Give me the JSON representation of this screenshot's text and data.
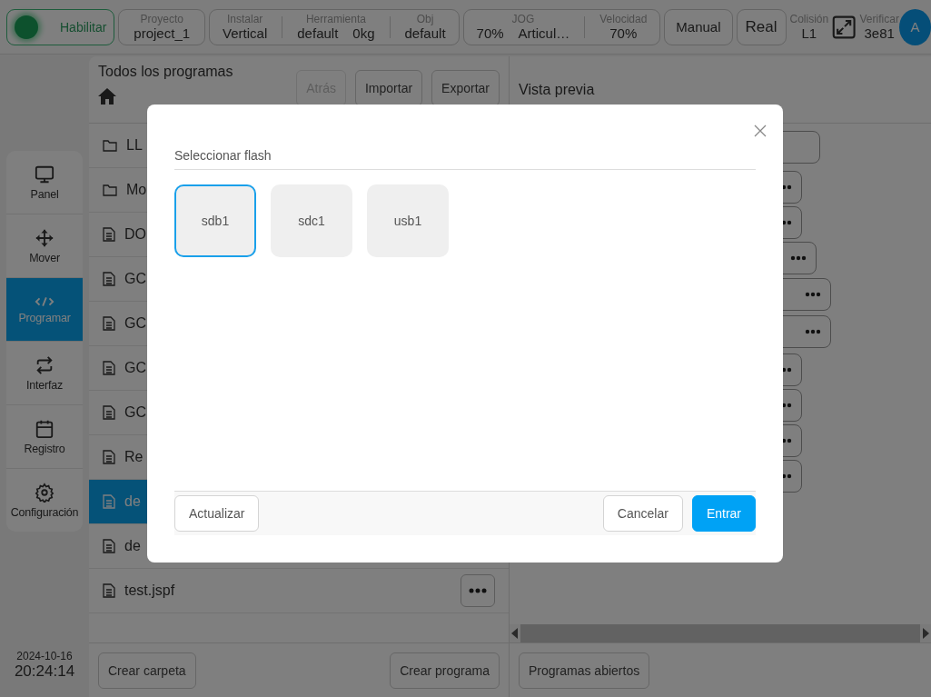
{
  "status_bar": {
    "enable": {
      "label": "Habilitar",
      "on": true
    },
    "project": {
      "label": "Proyecto",
      "value": "project_1"
    },
    "install_group": [
      {
        "label": "Instalar",
        "values": [
          "Vertical"
        ]
      },
      {
        "label": "Herramienta",
        "values": [
          "default",
          "0kg"
        ]
      },
      {
        "label": "Obj",
        "values": [
          "default"
        ]
      }
    ],
    "jog_group": [
      {
        "label": "JOG",
        "values": [
          "70%",
          "Articul…"
        ]
      },
      {
        "label": "Velocidad",
        "values": [
          "70%"
        ]
      }
    ],
    "mode_buttons": [
      "Manual",
      "Real"
    ],
    "collision": {
      "label": "Colisión",
      "value": "L1"
    },
    "verify": {
      "label": "Verificar",
      "value": "3e81"
    },
    "avatar": "A"
  },
  "sidebar": {
    "items": [
      {
        "label": "Panel",
        "selected": false
      },
      {
        "label": "Mover",
        "selected": false
      },
      {
        "label": "Programar",
        "selected": true
      },
      {
        "label": "Interfaz",
        "selected": false
      },
      {
        "label": "Registro",
        "selected": false
      },
      {
        "label": "Configuración",
        "selected": false
      }
    ],
    "date": "2024-10-16",
    "time": "20:24:14"
  },
  "file_panel": {
    "title": "Todos los programas",
    "buttons": [
      {
        "label": "Atrás",
        "disabled": true
      },
      {
        "label": "Importar",
        "disabled": false
      },
      {
        "label": "Exportar",
        "disabled": false
      }
    ],
    "rows": [
      {
        "kind": "folder",
        "name": "LL",
        "selected": false
      },
      {
        "kind": "folder",
        "name": "Mo",
        "selected": false
      },
      {
        "kind": "file",
        "name": "DO",
        "selected": false
      },
      {
        "kind": "file",
        "name": "GC",
        "selected": false
      },
      {
        "kind": "file",
        "name": "GC",
        "selected": false
      },
      {
        "kind": "file",
        "name": "GC",
        "selected": false
      },
      {
        "kind": "file",
        "name": "GC",
        "selected": false
      },
      {
        "kind": "file",
        "name": "Re",
        "selected": false
      },
      {
        "kind": "file",
        "name": "de",
        "selected": true
      },
      {
        "kind": "file",
        "name": "de",
        "selected": false
      },
      {
        "kind": "file",
        "name": "test.jspf",
        "selected": false,
        "menu": true
      }
    ],
    "footer_buttons": [
      "Crear carpeta",
      "Crear programa"
    ]
  },
  "preview": {
    "title": "Vista previa",
    "blocks": [
      {
        "menu": false
      },
      {
        "menu": true
      },
      {
        "menu": true
      },
      {
        "menu": true
      },
      {
        "menu": true
      },
      {
        "menu": true
      },
      {
        "menu": true
      },
      {
        "menu": true
      },
      {
        "menu": true
      },
      {
        "menu": true
      }
    ],
    "footer_buttons": [
      "Programas abiertos"
    ]
  },
  "dialog": {
    "title": "Seleccionar flash",
    "devices": [
      {
        "label": "sdb1",
        "selected": true
      },
      {
        "label": "sdc1",
        "selected": false
      },
      {
        "label": "usb1",
        "selected": false
      }
    ],
    "left_buttons": [
      "Actualizar"
    ],
    "right_buttons": [
      {
        "label": "Cancelar",
        "kind": "default"
      },
      {
        "label": "Entrar",
        "kind": "primary"
      }
    ]
  }
}
